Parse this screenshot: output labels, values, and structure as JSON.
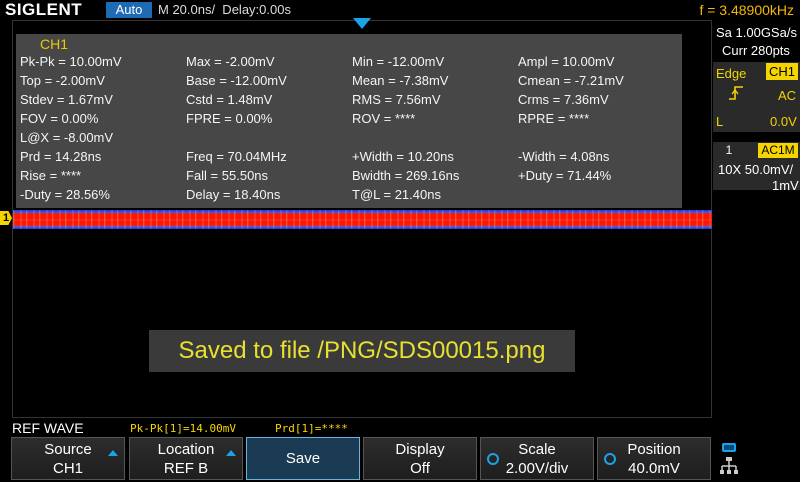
{
  "topbar": {
    "logo": "SIGLENT",
    "mode": "Auto",
    "timebase": "M 20.0ns/  Delay:0.00s",
    "frequency": "f = 3.48900kHz"
  },
  "measure": {
    "title": "CH1",
    "rows": [
      [
        "Pk-Pk = 10.00mV",
        "Max = -2.00mV",
        "Min = -12.00mV",
        "Ampl = 10.00mV"
      ],
      [
        "Top = -2.00mV",
        "Base = -12.00mV",
        "Mean = -7.38mV",
        "Cmean = -7.21mV"
      ],
      [
        "Stdev = 1.67mV",
        "Cstd = 1.48mV",
        "RMS = 7.56mV",
        "Crms = 7.36mV"
      ],
      [
        "FOV = 0.00%",
        "FPRE = 0.00%",
        "ROV = ****",
        "RPRE = ****"
      ],
      [
        "L@X = -8.00mV",
        "",
        "",
        ""
      ],
      [
        "Prd = 14.28ns",
        "Freq = 70.04MHz",
        "+Width = 10.20ns",
        "-Width = 4.08ns"
      ],
      [
        "Rise = ****",
        "Fall = 55.50ns",
        "Bwidth = 269.16ns",
        "+Duty = 71.44%"
      ],
      [
        "-Duty = 28.56%",
        "Delay = 18.40ns",
        "T@L = 21.40ns",
        ""
      ]
    ]
  },
  "channel_marker": "1",
  "message": "Saved to file /PNG/SDS00015.png",
  "right_panel": {
    "sample_rate": "Sa 1.00GSa/s",
    "curr_pts": "Curr 280pts",
    "trigger_type": "Edge",
    "trigger_source": "CH1",
    "trigger_coupling": "AC",
    "level_label": "L",
    "level_value": "0.0V",
    "channel_number": "1",
    "channel_coupling": "AC1M",
    "channel_scale": "10X  50.0mV/",
    "channel_offset": "1mV"
  },
  "status": {
    "ref_wave": "REF WAVE",
    "pkpk": "Pk-Pk[1]=14.00mV",
    "prd": "Prd[1]=****"
  },
  "softkeys": {
    "source_label": "Source",
    "source_value": "CH1",
    "location_label": "Location",
    "location_value": "REF B",
    "save_label": "Save",
    "display_label": "Display",
    "display_value": "Off",
    "scale_label": "Scale",
    "scale_value": "2.00V/div",
    "position_label": "Position",
    "position_value": "40.0mV"
  },
  "colors": {
    "accent_blue": "#1aa3e8",
    "trigger_yellow": "#f5d500",
    "freq_orange": "#f5b800",
    "waveform_red": "#ff1500",
    "waveform_blue": "#1a2fd0"
  },
  "icons": {
    "trigger_edge": "rising-edge-icon",
    "network": "network-icon"
  }
}
